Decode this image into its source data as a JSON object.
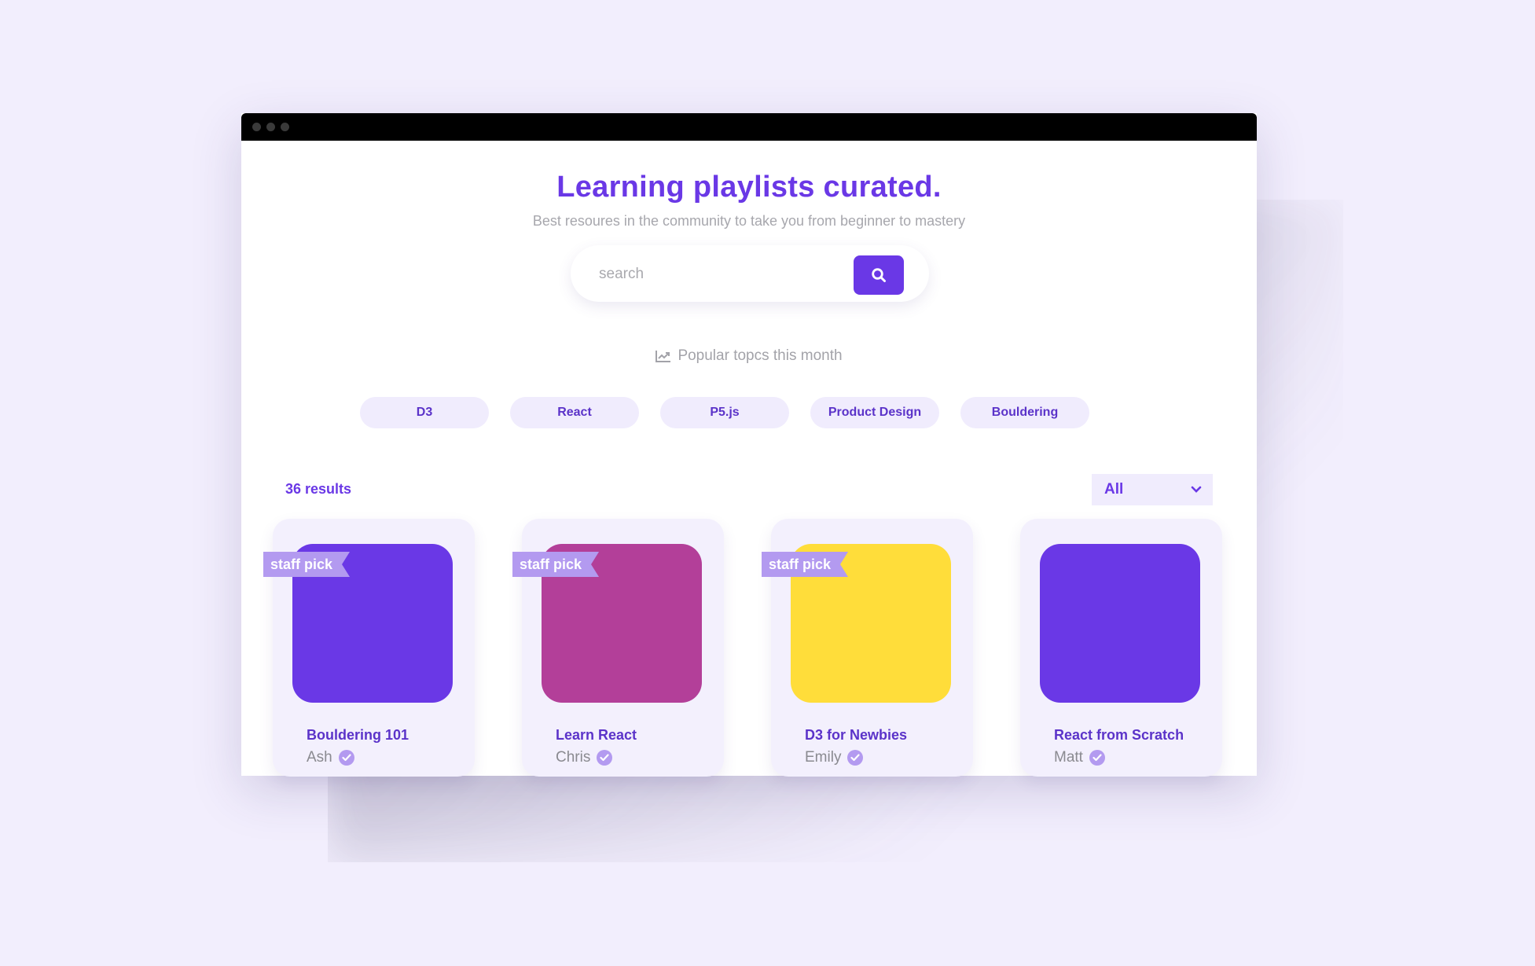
{
  "header": {
    "title": "Learning playlists curated.",
    "subtitle": "Best resoures in the community to take you from beginner to mastery"
  },
  "search": {
    "placeholder": "search",
    "value": "",
    "button_icon": "search-icon"
  },
  "popular": {
    "icon": "trending-chart-icon",
    "label": "Popular topcs this month"
  },
  "topics": [
    "D3",
    "React",
    "P5.js",
    "Product Design",
    "Bouldering"
  ],
  "results": {
    "count_label": "36 results"
  },
  "filter": {
    "selected": "All",
    "icon": "chevron-down-icon"
  },
  "cards": [
    {
      "title": "Bouldering 101",
      "author": "Ash",
      "staff_pick": true,
      "badge": "staff pick",
      "color": "#6a38e6",
      "verified": true
    },
    {
      "title": "Learn React",
      "author": "Chris",
      "staff_pick": true,
      "badge": "staff pick",
      "color": "#b33f99",
      "verified": true
    },
    {
      "title": "D3 for Newbies",
      "author": "Emily",
      "staff_pick": true,
      "badge": "staff pick",
      "color": "#ffdd3a",
      "verified": true
    },
    {
      "title": "React from Scratch",
      "author": "Matt",
      "staff_pick": false,
      "badge": "",
      "color": "#6a38e6",
      "verified": true
    }
  ],
  "colors": {
    "accent": "#6a38e6",
    "chip_bg": "#f0ecfd",
    "badge_bg": "#b39af0",
    "page_bg": "#f2eefd"
  }
}
